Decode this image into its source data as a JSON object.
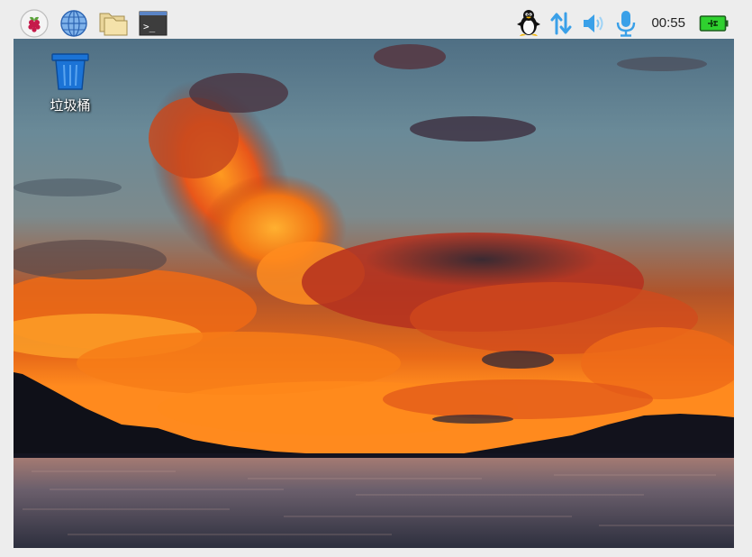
{
  "taskbar": {
    "launchers": [
      {
        "icon": "raspberry-pi-menu-icon"
      },
      {
        "icon": "web-browser-globe-icon"
      },
      {
        "icon": "file-manager-folder-icon"
      },
      {
        "icon": "terminal-icon",
        "glyph": ">_"
      }
    ],
    "tray": {
      "icons": [
        "linux-tux-icon",
        "network-updown-arrows-icon",
        "volume-speaker-icon",
        "microphone-icon",
        "battery-charging-icon"
      ],
      "clock": "00:55"
    }
  },
  "desktop": {
    "icons": [
      {
        "label": "垃圾桶",
        "icon": "trash-bin-icon"
      }
    ]
  },
  "colors": {
    "panel": "#ededed",
    "tray_accent": "#3aa0e8",
    "battery_green": "#2fd12f",
    "trash_blue": "#1b73d6"
  }
}
